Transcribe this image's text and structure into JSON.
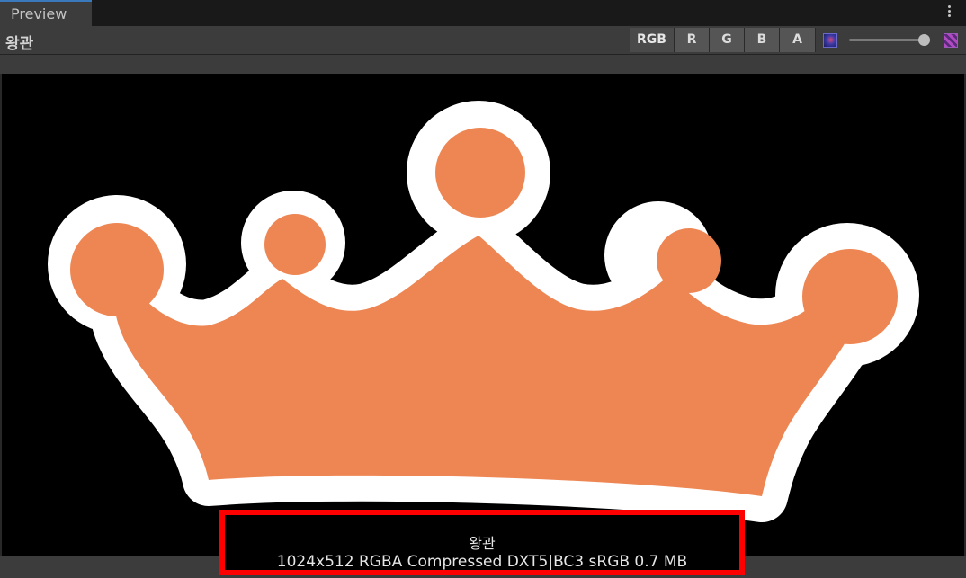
{
  "tab": {
    "label": "Preview"
  },
  "toolbar": {
    "title": "왕관",
    "channels": [
      {
        "label": "RGB",
        "active": true
      },
      {
        "label": "R",
        "active": false
      },
      {
        "label": "G",
        "active": false
      },
      {
        "label": "B",
        "active": false
      },
      {
        "label": "A",
        "active": false
      }
    ],
    "mip_slider": {
      "value": 1.0
    },
    "icons": [
      "kebab-menu-icon",
      "mip-low-icon",
      "mip-high-icon"
    ]
  },
  "preview": {
    "background_color": "#000000",
    "crown_fill": "#ee8653",
    "crown_outline": "#ffffff"
  },
  "info": {
    "name": "왕관",
    "details": "1024x512  RGBA Compressed DXT5|BC3 sRGB   0.7 MB"
  }
}
